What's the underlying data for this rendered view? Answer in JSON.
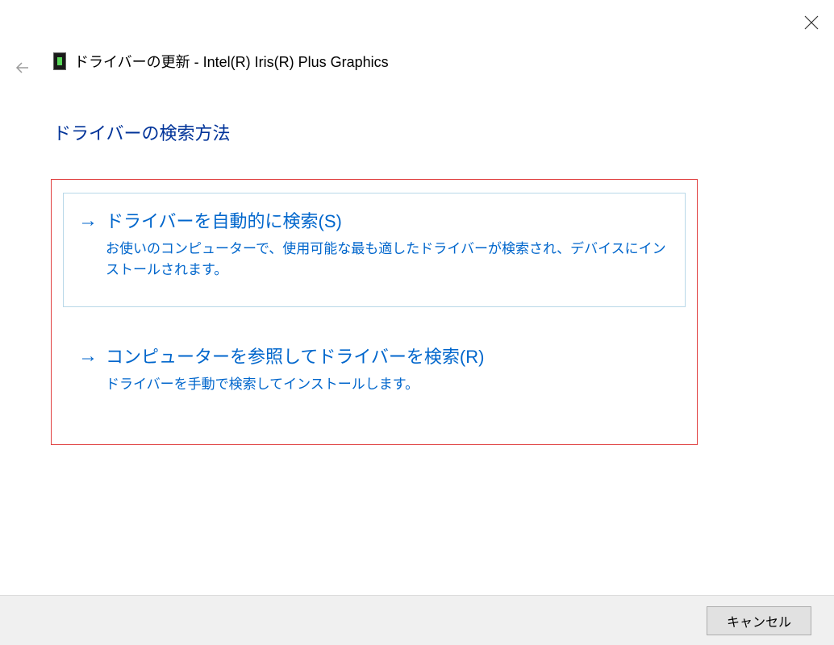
{
  "window": {
    "title": "ドライバーの更新 - Intel(R) Iris(R) Plus Graphics"
  },
  "heading": "ドライバーの検索方法",
  "options": [
    {
      "title": "ドライバーを自動的に検索(S)",
      "description": "お使いのコンピューターで、使用可能な最も適したドライバーが検索され、デバイスにインストールされます。"
    },
    {
      "title": "コンピューターを参照してドライバーを検索(R)",
      "description": "ドライバーを手動で検索してインストールします。"
    }
  ],
  "footer": {
    "cancel_label": "キャンセル"
  }
}
